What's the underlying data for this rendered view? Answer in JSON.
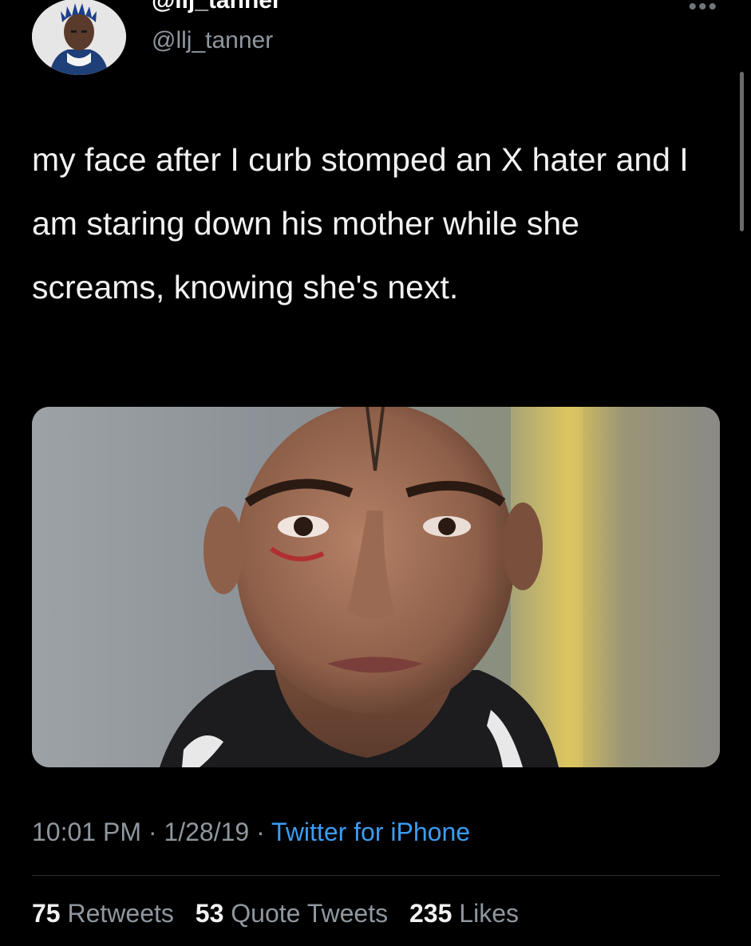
{
  "user": {
    "display_name": "@llj_tanner",
    "handle": "@llj_tanner",
    "more_icon": "more-dots-icon"
  },
  "tweet": {
    "text": "my face after I curb stomped an X hater and I am staring down his mother while she screams, knowing she's next."
  },
  "meta": {
    "time": "10:01 PM",
    "date": "1/28/19",
    "separator": "·",
    "source": "Twitter for iPhone"
  },
  "stats": {
    "retweets_count": "75",
    "retweets_label": "Retweets",
    "quotes_count": "53",
    "quotes_label": "Quote Tweets",
    "likes_count": "235",
    "likes_label": "Likes"
  },
  "colors": {
    "background": "#000000",
    "text_primary": "#f2f2f2",
    "text_secondary": "#8f979f",
    "link": "#3a9cf2"
  }
}
